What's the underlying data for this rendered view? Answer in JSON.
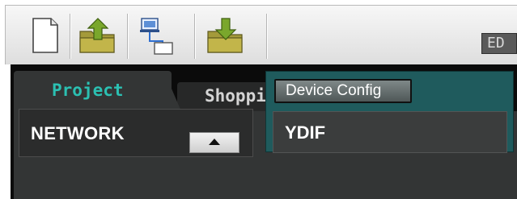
{
  "toolbar": {
    "buttons": [
      {
        "id": "new",
        "icon": "new-file-icon"
      },
      {
        "id": "open",
        "icon": "open-folder-icon"
      },
      {
        "id": "network",
        "icon": "network-setup-icon"
      },
      {
        "id": "save",
        "icon": "save-folder-icon"
      }
    ],
    "mode_badge": "ED"
  },
  "tabs": [
    {
      "label": "Project",
      "active": true
    },
    {
      "label": "Shopping Mall",
      "active": false
    }
  ],
  "left_panel": {
    "title": "NETWORK",
    "scroll_icon": "scroll-up-arrow-icon"
  },
  "device_area": {
    "config_button": "Device Config",
    "device_label": "YDIF"
  },
  "colors": {
    "active_tab_text": "#2bc0b2",
    "inactive_tab_text": "#d4d4d4",
    "device_area_bg": "#1f5b5d",
    "folder_green": "#7aa72c",
    "folder_olive": "#a49a3a"
  }
}
